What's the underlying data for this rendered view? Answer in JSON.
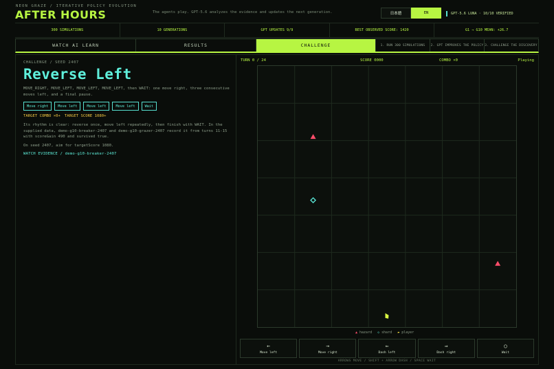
{
  "header": {
    "subtitle": "NEON GRAZE / ITERATIVE POLICY EVOLUTION",
    "title": "AFTER HOURS",
    "tagline": "The agents play. GPT-5.6 analyzes the evidence and updates the next generation.",
    "languages": [
      "日本語",
      "EN"
    ],
    "active_language": "EN",
    "model_status": "GPT-5.6 LUNA · 10/10 VERIFIED"
  },
  "stats": [
    "300 SIMULATIONS",
    "10 GENERATIONS",
    "GPT UPDATES 9/9",
    "BEST OBSERVED SCORE: 1420",
    "G1 → G10 MEAN: +26.7"
  ],
  "tabs": {
    "watch": "WATCH AI LEARN",
    "results": "RESULTS",
    "challenge": "CHALLENGE",
    "steps": [
      "1. RUN 300 SIMULATIONS",
      "2. GPT IMPROVES THE POLICY",
      "3. CHALLENGE THE DISCOVERY"
    ]
  },
  "challenge": {
    "crumb": "CHALLENGE / SEED 2407",
    "title": "Reverse Left",
    "description": "MOVE_RIGHT, MOVE_LEFT, MOVE_LEFT, MOVE_LEFT, then WAIT: one move right, three consecutive moves left, and a final pause.",
    "sequence": [
      "Move right",
      "Move left",
      "Move left",
      "Move left",
      "Wait"
    ],
    "target_combo": "TARGET COMBO ×0+",
    "target_score": "TARGET SCORE 1080+",
    "rhythm": "Its rhythm is clear: reverse once, move left repeatedly, then finish with WAIT. In the supplied data, demo-g10-breaker-2407 and demo-g10-grazer-2407 record it from turns 11-15 with scoreGain 490 and survived true.",
    "seed_line": "On seed 2407, aim for targetScore 1080.",
    "evidence_link": "WATCH EVIDENCE / demo-g10-breaker-2407"
  },
  "game": {
    "turn": "TURN 0 / 24",
    "score": "SCORE 0000",
    "combo": "COMBO ×0",
    "status": "Playing",
    "grid": {
      "cols": 7,
      "rows": 7
    },
    "pieces": [
      {
        "kind": "hazard",
        "col": 1.5,
        "row": 1.9
      },
      {
        "kind": "shard",
        "col": 1.5,
        "row": 3.6
      },
      {
        "kind": "hazard",
        "col": 6.5,
        "row": 5.3
      },
      {
        "kind": "player",
        "col": 3.5,
        "row": 6.7
      }
    ],
    "colors": {
      "hazard": "#ff4d6a",
      "shard": "#57e0d0",
      "player": "#d8f542",
      "grid": "#1e2a1e"
    },
    "legend": {
      "hazard": "hazard",
      "shard": "shard",
      "player": "player"
    }
  },
  "controls": [
    {
      "glyph": "←",
      "label": "Move left"
    },
    {
      "glyph": "→",
      "label": "Move right"
    },
    {
      "glyph": "⇐",
      "label": "Dash left"
    },
    {
      "glyph": "⇒",
      "label": "Dash right"
    },
    {
      "glyph": "○",
      "label": "Wait"
    }
  ],
  "key_hint": "ARROWS MOVE / SHIFT + ARROW DASH / SPACE WAIT"
}
